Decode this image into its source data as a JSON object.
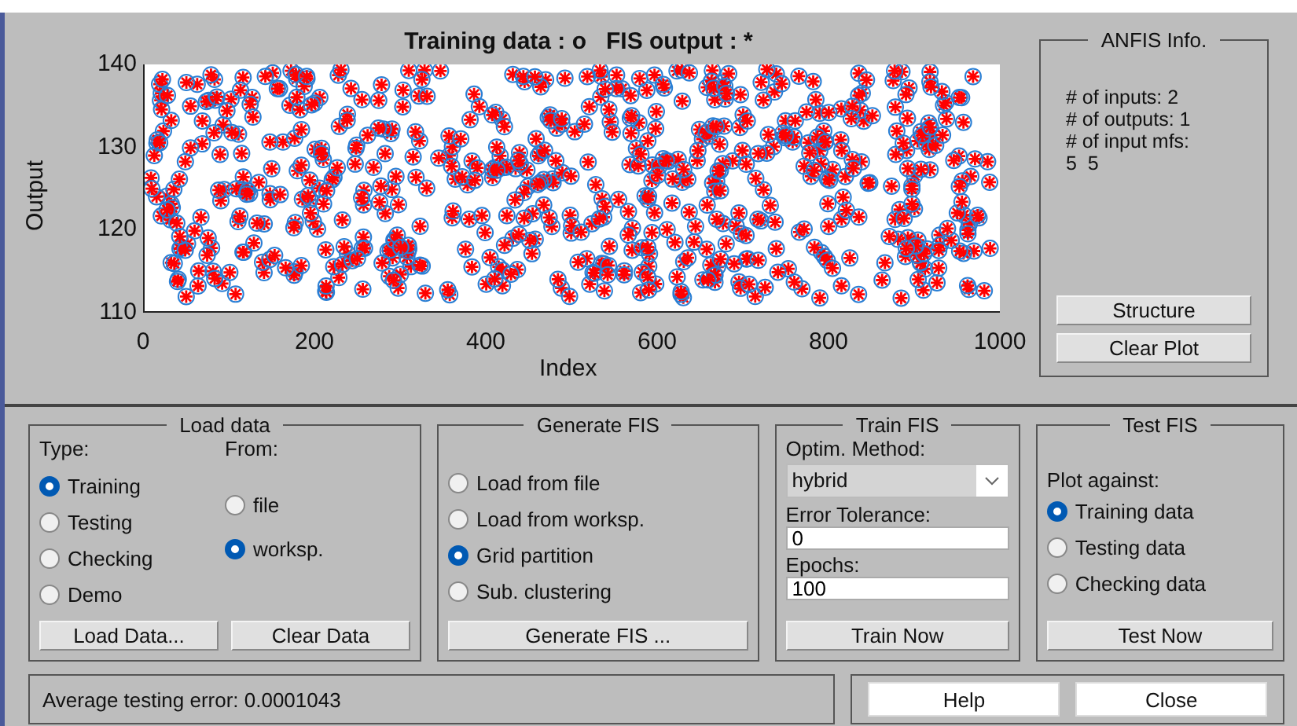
{
  "plot": {
    "title": "Training data : o   FIS output : *",
    "ylabel": "Output",
    "xlabel": "Index",
    "yticks": [
      "140",
      "130",
      "120",
      "110"
    ],
    "xticks": [
      "0",
      "200",
      "400",
      "600",
      "800",
      "1000"
    ]
  },
  "info": {
    "title": "ANFIS Info.",
    "lines": [
      "# of inputs: 2",
      "# of outputs: 1",
      "# of input mfs:",
      "5  5"
    ],
    "buttons": [
      "Structure",
      "Clear Plot"
    ]
  },
  "load_data": {
    "title": "Load data",
    "type_label": "Type:",
    "from_label": "From:",
    "types": [
      {
        "label": "Training",
        "selected": true
      },
      {
        "label": "Testing",
        "selected": false
      },
      {
        "label": "Checking",
        "selected": false
      },
      {
        "label": "Demo",
        "selected": false
      }
    ],
    "sources": [
      {
        "label": "file",
        "selected": false
      },
      {
        "label": "worksp.",
        "selected": true
      }
    ],
    "buttons": [
      "Load Data...",
      "Clear Data"
    ]
  },
  "generate_fis": {
    "title": "Generate FIS",
    "options": [
      {
        "label": "Load from file",
        "selected": false
      },
      {
        "label": "Load from worksp.",
        "selected": false
      },
      {
        "label": "Grid partition",
        "selected": true
      },
      {
        "label": "Sub. clustering",
        "selected": false
      }
    ],
    "button": "Generate FIS ..."
  },
  "train_fis": {
    "title": "Train FIS",
    "method_label": "Optim. Method:",
    "method": "hybrid",
    "tolerance_label": "Error Tolerance:",
    "tolerance": "0",
    "epochs_label": "Epochs:",
    "epochs": "100",
    "button": "Train Now"
  },
  "test_fis": {
    "title": "Test FIS",
    "plot_label": "Plot against:",
    "options": [
      {
        "label": "Training data",
        "selected": true
      },
      {
        "label": "Testing data",
        "selected": false
      },
      {
        "label": "Checking data",
        "selected": false
      }
    ],
    "button": "Test Now"
  },
  "status": "Average testing error: 0.0001043",
  "buttons": [
    "Help",
    "Close"
  ]
}
